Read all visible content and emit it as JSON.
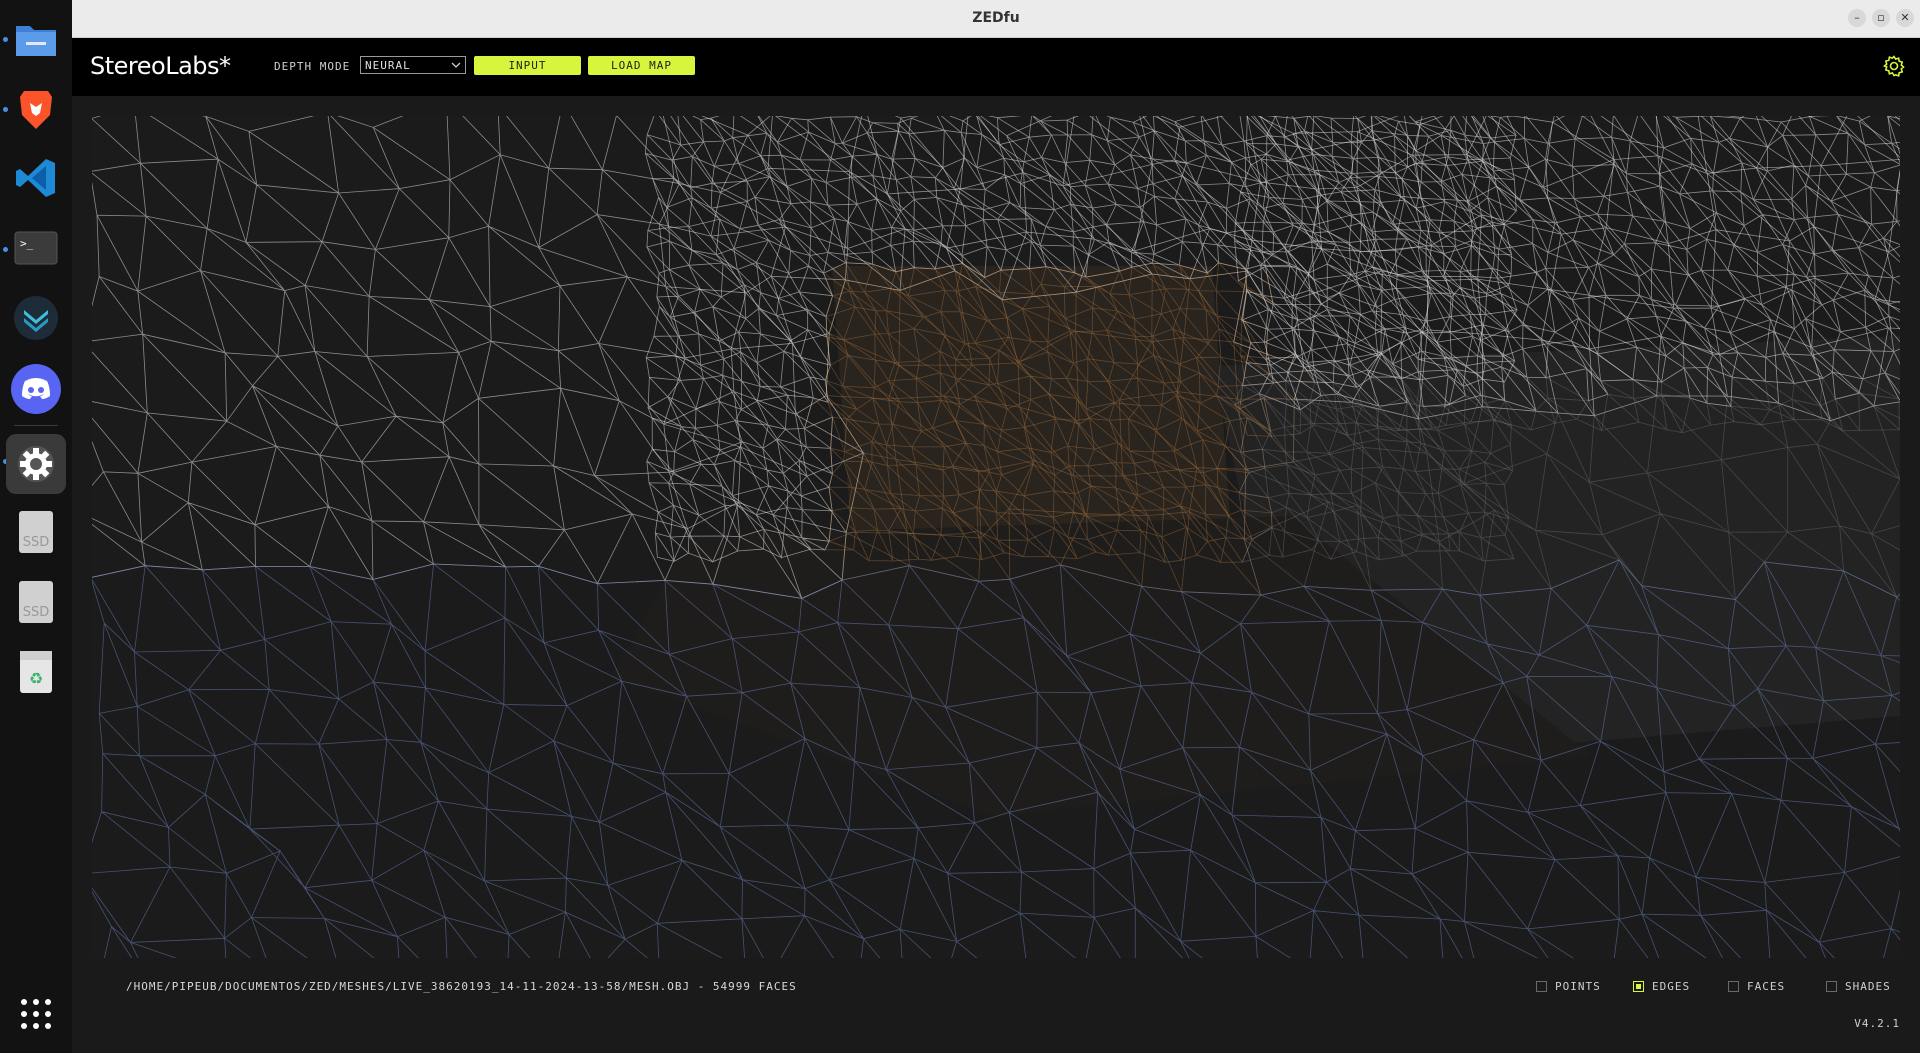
{
  "window": {
    "title": "ZEDfu"
  },
  "dock": {
    "items": [
      {
        "name": "files",
        "active": false
      },
      {
        "name": "brave",
        "active": false
      },
      {
        "name": "vscode",
        "active": false
      },
      {
        "name": "terminal",
        "active": false
      },
      {
        "name": "mailspring",
        "active": false
      },
      {
        "name": "discord",
        "active": false
      },
      {
        "name": "settings",
        "active": true
      },
      {
        "name": "ssd-drive-1",
        "label": "SSD"
      },
      {
        "name": "ssd-drive-2",
        "label": "SSD"
      },
      {
        "name": "trash"
      },
      {
        "name": "app-grid"
      }
    ]
  },
  "header": {
    "brand": "StereoLabs*",
    "depth_mode_label": "DEPTH MODE",
    "depth_mode_value": "NEURAL",
    "input_button": "INPUT",
    "load_map_button": "LOAD MAP",
    "accent_color": "#d7f53c"
  },
  "footer": {
    "status": "/HOME/PIPEUB/DOCUMENTOS/ZED/MESHES/LIVE_38620193_14-11-2024-13-58/MESH.OBJ - 54999 FACES",
    "options": {
      "points": {
        "label": "POINTS",
        "checked": false
      },
      "edges": {
        "label": "EDGES",
        "checked": true
      },
      "faces": {
        "label": "FACES",
        "checked": false
      },
      "shades": {
        "label": "SHADES",
        "checked": false
      }
    },
    "version": "V4.2.1"
  }
}
